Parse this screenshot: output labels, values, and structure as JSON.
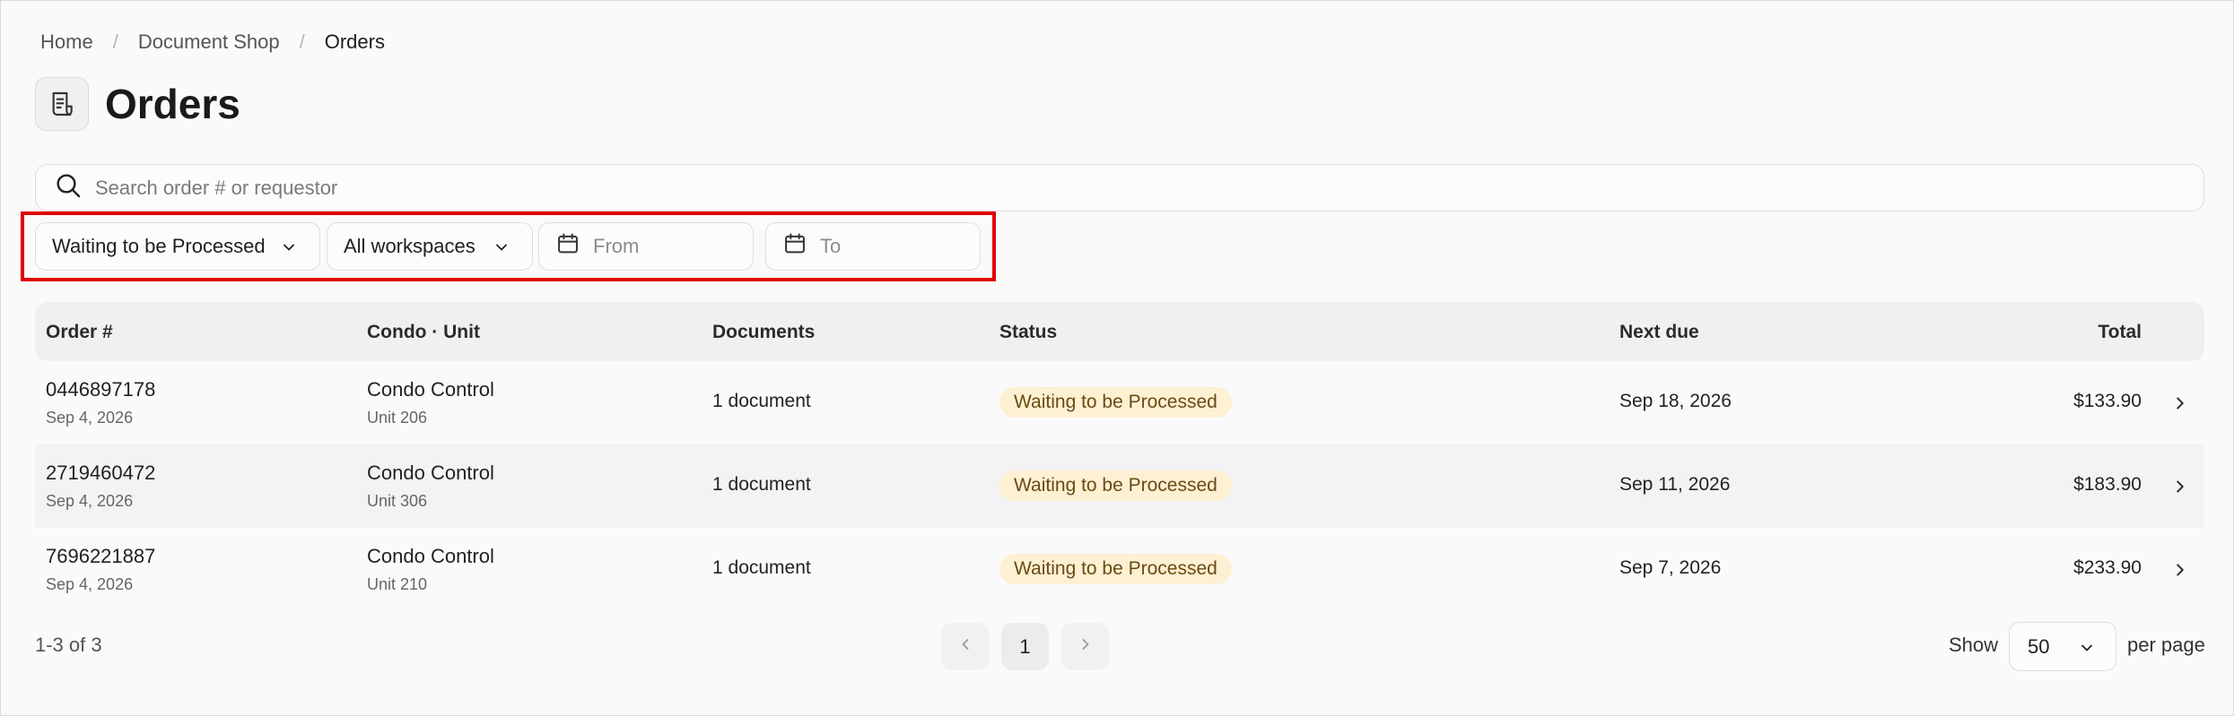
{
  "breadcrumb": {
    "items": [
      "Home",
      "Document Shop"
    ],
    "separator": "/",
    "current": "Orders"
  },
  "page": {
    "title": "Orders",
    "icon": "receipt-icon"
  },
  "search": {
    "placeholder": "Search order # or requestor",
    "value": ""
  },
  "filters": {
    "status": "Waiting to be Processed",
    "workspace": "All workspaces",
    "from_placeholder": "From",
    "to_placeholder": "To"
  },
  "table": {
    "columns": {
      "order": "Order #",
      "condo": "Condo · Unit",
      "documents": "Documents",
      "status": "Status",
      "next_due": "Next due",
      "total": "Total"
    },
    "rows": [
      {
        "order": "0446897178",
        "date": "Sep 4, 2026",
        "condo": "Condo Control",
        "unit": "Unit 206",
        "documents": "1 document",
        "status": "Waiting to be Processed",
        "next_due": "Sep 18, 2026",
        "total": "$133.90"
      },
      {
        "order": "2719460472",
        "date": "Sep 4, 2026",
        "condo": "Condo Control",
        "unit": "Unit 306",
        "documents": "1 document",
        "status": "Waiting to be Processed",
        "next_due": "Sep 11, 2026",
        "total": "$183.90"
      },
      {
        "order": "7696221887",
        "date": "Sep 4, 2026",
        "condo": "Condo Control",
        "unit": "Unit 210",
        "documents": "1 document",
        "status": "Waiting to be Processed",
        "next_due": "Sep 7, 2026",
        "total": "$233.90"
      }
    ]
  },
  "pagination": {
    "range": "1-3 of 3",
    "current_page": "1",
    "show_label": "Show",
    "per_page": "50",
    "per_page_label": "per page"
  },
  "colors": {
    "badge_bg": "#fdf0d3",
    "badge_text": "#6b4a12",
    "highlight": "#e00000"
  }
}
